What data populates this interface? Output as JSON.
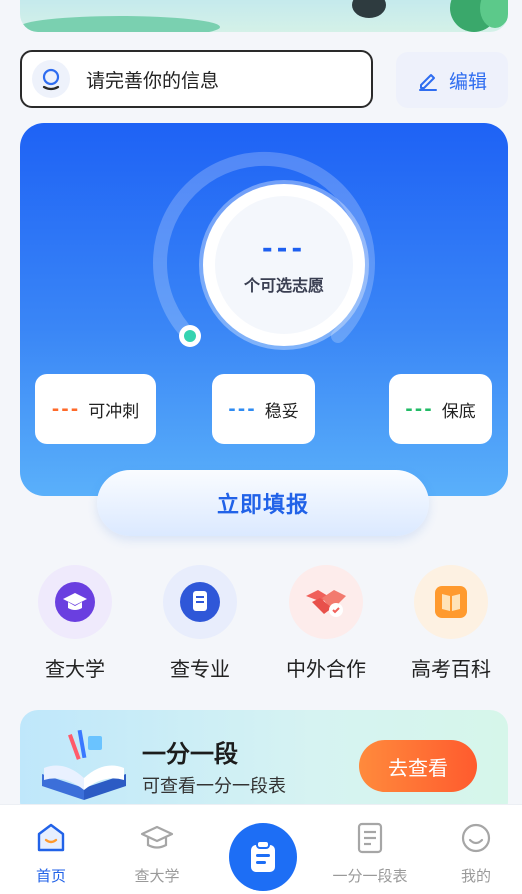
{
  "profile": {
    "prompt": "请完善你的信息",
    "edit_label": "编辑"
  },
  "summary": {
    "count": "---",
    "count_label": "个可选志愿",
    "rush": {
      "dash": "---",
      "label": "可冲刺",
      "color": "#ff6a2a"
    },
    "steady": {
      "dash": "---",
      "label": "稳妥",
      "color": "#2f8bf2"
    },
    "safe": {
      "dash": "---",
      "label": "保底",
      "color": "#22bb66"
    },
    "progress_fraction": 0.0
  },
  "fill_button": "立即填报",
  "quick_links": [
    {
      "label": "查大学",
      "icon": "graduation-cap-icon"
    },
    {
      "label": "查专业",
      "icon": "bookmark-icon"
    },
    {
      "label": "中外合作",
      "icon": "handshake-icon"
    },
    {
      "label": "高考百科",
      "icon": "book-icon"
    }
  ],
  "promo": {
    "title": "一分一段",
    "subtitle": "可查看一分一段表",
    "button": "去查看"
  },
  "tabs": [
    {
      "label": "首页",
      "icon": "home-icon",
      "active": true
    },
    {
      "label": "查大学",
      "icon": "graduation-cap-icon",
      "active": false
    },
    {
      "label": "",
      "icon": "clipboard-icon",
      "active": false
    },
    {
      "label": "一分一段表",
      "icon": "document-icon",
      "active": false
    },
    {
      "label": "我的",
      "icon": "profile-icon",
      "active": false
    }
  ],
  "colors": {
    "accent": "#2162e8",
    "card_top": "#1e62f5",
    "card_bottom": "#5ab0fa",
    "promo_button": "#ff6a33"
  }
}
